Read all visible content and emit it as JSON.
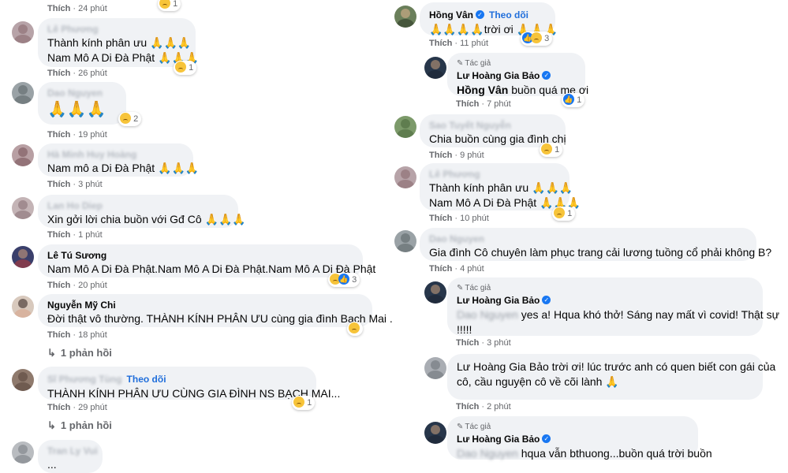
{
  "actions": {
    "like": "Thích"
  },
  "left": {
    "top_meta": "24 phút",
    "c1": {
      "name": "Lê Phương",
      "lines": [
        "Thành kính phân ưu 🙏🙏🙏",
        "Nam Mô A Di Đà Phật 🙏🙏🙏"
      ],
      "time": "26 phút",
      "reactions": "1"
    },
    "c2": {
      "name": "Dao Nguyen",
      "text": "🙏🙏🙏",
      "time": "19 phút",
      "reactions": "2"
    },
    "c3": {
      "name": "Hà Minh Huy Hoàng",
      "text": "Nam mô a Di Đà Phật 🙏🙏🙏",
      "time": "3 phút"
    },
    "c4": {
      "name": "Lan Ho Diep",
      "text": "Xin gởi lời chia buồn với Gđ Cô 🙏🙏🙏",
      "time": "1 phút"
    },
    "c5": {
      "name": "Lê Tú Sương",
      "text": "Nam Mô A Di Đà Phật.Nam Mô A Di Đà Phật.Nam Mô A Di Đà Phật",
      "time": "20 phút",
      "reactions": "3"
    },
    "c6": {
      "name": "Nguyễn Mỹ Chi",
      "text": "Đời thật vô thường. THÀNH KÍNH PHÂN ƯU cùng gia đình Bạch Mai .",
      "time": "18 phút",
      "replies": "1 phản hồi"
    },
    "c7": {
      "name": "Sĩ Phương Tùng",
      "follow": "Theo dõi",
      "text": "THÀNH KÍNH PHÂN ƯU CÙNG GIA ĐÌNH NS BẠCH MAI...",
      "time": "29 phút",
      "reactions": "1",
      "replies": "1 phản hồi"
    },
    "c8": {
      "name": "Tran Ly Vui",
      "text": "..."
    }
  },
  "right": {
    "r1": {
      "name": "Hồng Vân",
      "follow": "Theo dõi",
      "text": "🙏🙏🙏🙏trời ơi 🙏🙏🙏",
      "time": "11 phút",
      "reactions": "3"
    },
    "r2": {
      "tag": "Tác giả",
      "name": "Lư Hoàng Gia Bảo",
      "mention": "Hồng Vân",
      "text": " buồn quá mẹ ơi",
      "time": "7 phút",
      "reactions": "1"
    },
    "r3": {
      "name": "Sao Tuyết Nguyễn",
      "text": "Chia buồn cùng gia đình chị",
      "time": "9 phút",
      "reactions": "1"
    },
    "r4": {
      "name": "Lê Phương",
      "lines": [
        "Thành kính phân ưu 🙏🙏🙏",
        "Nam Mô A Di Đà Phật 🙏🙏🙏"
      ],
      "time": "10 phút",
      "reactions": "1"
    },
    "r5": {
      "name": "Dao Nguyen",
      "text": "Gia đình Cô chuyên làm phục trang cải lương tuồng cổ phải không B?",
      "time": "4 phút"
    },
    "r6": {
      "tag": "Tác giả",
      "name": "Lư Hoàng Gia Bảo",
      "mention": "Dao Nguyen",
      "line1": " yes a! Hqua khó thở! Sáng nay mất vì covid! Thật sự",
      "line2": "!!!!!",
      "time": "3 phút"
    },
    "r7": {
      "name": "Lư Hoàng Gia Bảo",
      "line1": "Lư Hoàng Gia Bảo trời ơi! lúc trước anh có quen biết con gái của",
      "line2": "cô, cầu nguyện cô về cõi lành 🙏",
      "time": "2 phút"
    },
    "r8": {
      "tag": "Tác giả",
      "name": "Lư Hoàng Gia Bảo",
      "mention": "Dao Nguyen",
      "text": " hqua vẫn bthuong...buồn quá trời buồn"
    }
  },
  "colors": {
    "bubble": "#f0f2f5",
    "link": "#216fdb",
    "meta": "#65676b",
    "verified": "#1877f2"
  }
}
